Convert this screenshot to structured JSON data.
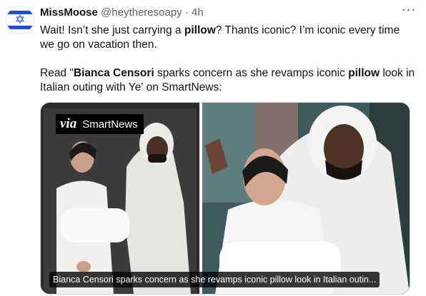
{
  "tweet": {
    "display_name": "MissMoose",
    "handle": "@heytheresoapy",
    "separator": "·",
    "time": "4h",
    "more_label": "···",
    "avatar_glyph": "✡",
    "paragraph1": {
      "t1": "Wait! Isn’t she just carrying a ",
      "b1": "pillow",
      "t2": "?  Thants iconic?  I’m iconic every time we go on vacation then."
    },
    "paragraph2": {
      "t1": "Read \"",
      "b1": "Bianca Censori",
      "t2": " sparks concern as she revamps iconic ",
      "b2": "pillow",
      "t3": " look in Italian outing with Ye' on SmartNews:"
    }
  },
  "card": {
    "via_label": "via",
    "source_label": "SmartNews",
    "caption": "Bianca Censori sparks concern as she revamps iconic pillow look in Italian outin..."
  },
  "colors": {
    "flag_blue": "#1e4fd8",
    "text_primary": "#0f1419",
    "text_secondary": "#536471"
  }
}
